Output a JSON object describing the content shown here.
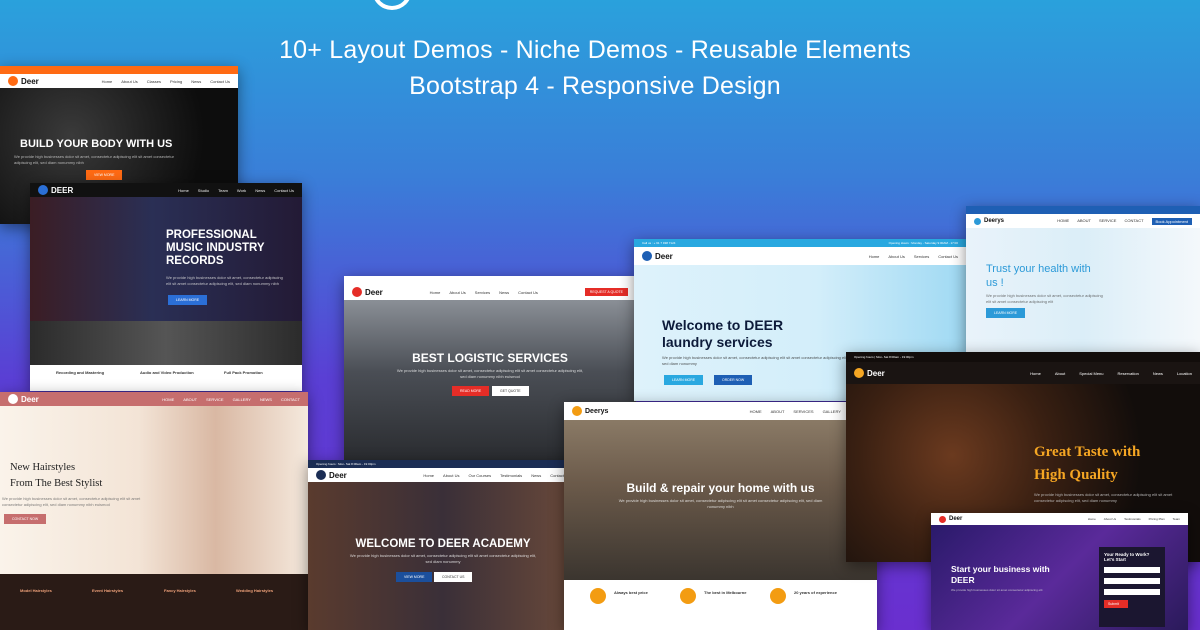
{
  "headline": {
    "line1": "10+ Layout Demos - Niche Demos - Reusable Elements",
    "line2": "Bootstrap 4 - Responsive Design"
  },
  "colors": {
    "fitness": "#ff6a13",
    "logistic": "#e52d27",
    "laundry": "#29a8e0",
    "coffee": "#f5a623",
    "construct": "#f39c12"
  },
  "demos": {
    "fitness": {
      "brand": "Deer",
      "menu": [
        "Home",
        "About Us",
        "Classes",
        "Pricing",
        "News",
        "Contact Us"
      ],
      "title": "BUILD YOUR BODY WITH US",
      "sub": "We provide high businesses dolor sit amet, consectetur adipiscing elit sit amet consectetur adipiscing elit, sed diam nonummy nibh",
      "btn": "VIEW MORE"
    },
    "music": {
      "brand": "DEER",
      "menu": [
        "Home",
        "Studio",
        "Team",
        "Work",
        "News",
        "Contact Us"
      ],
      "title": "PROFESSIONAL MUSIC INDUSTRY RECORDS",
      "sub": "We provide high businesses dolor sit amet, consectetur adipiscing elit sit amet consectetur adipiscing elit, sed diam nonummy nibh",
      "btn": "LEARN MORE",
      "features": [
        "Recording and Mastering",
        "Audio and Video Production",
        "Full Pack Promotion"
      ]
    },
    "salon": {
      "brand": "Deer",
      "menu": [
        "HOME",
        "ABOUT",
        "SERVICE",
        "GALLERY",
        "NEWS",
        "CONTACT"
      ],
      "title1": "New Hairstyles",
      "title2": "From The Best Stylist",
      "sub": "We provide high businesses dolor sit amet, consectetur adipiscing elit sit amet consectetur adipiscing elit, sed diam nonummy nibh euismod",
      "btn": "CONTACT NOW",
      "services": [
        "Model Hairstyles",
        "Event Hairstyles",
        "Fancy Hairstyles",
        "Wedding Hairstyles"
      ]
    },
    "logistic": {
      "brand": "Deer",
      "menu": [
        "Home",
        "About Us",
        "Services",
        "News",
        "Contact Us"
      ],
      "cta": "REQUEST A QUOTE",
      "title": "BEST LOGISTIC SERVICES",
      "sub": "We provide high businesses dolor sit amet, consectetur adipiscing elit sit amet consectetur adipiscing elit, sed diam nonummy nibh euismod",
      "btn1": "READ MORE",
      "btn2": "GET QUOTE"
    },
    "academy": {
      "topbar": "Opening hours : Mon- Sat 8:00am - 19:00pm",
      "brand": "Deer",
      "menu": [
        "Home",
        "About Us",
        "Our Courses",
        "Testimonials",
        "News",
        "Contact Us"
      ],
      "title": "WELCOME TO DEER ACADEMY",
      "sub": "We provide high businesses dolor sit amet, consectetur adipiscing elit sit amet consectetur adipiscing elit, sed diam nonummy",
      "btn1": "VIEW MORE",
      "btn2": "CONTACT US"
    },
    "laundry": {
      "topbar1": "Call us : + 61 7 938 7124",
      "topbar2": "Opening Hours : Monday - Saturday 9:00AM - 17:00",
      "brand": "Deer",
      "menu": [
        "Home",
        "About Us",
        "Services",
        "Contact Us"
      ],
      "title1": "Welcome to DEER",
      "title2": "laundry services",
      "sub": "We provide high businesses dolor sit amet, consectetur adipiscing elit sit amet consectetur adipiscing elit, sed diam nonummy",
      "btn1": "LEARN MORE",
      "btn2": "ORDER NOW"
    },
    "health": {
      "brand": "Deerys",
      "menu": [
        "HOME",
        "ABOUT",
        "SERVICE",
        "CONTACT"
      ],
      "cta": "Book Appointment",
      "title1": "Trust your health with",
      "title2": "us !",
      "sub": "We provide high businesses dolor sit amet, consectetur adipiscing elit sit amet consectetur adipiscing elit",
      "btn": "LEARN MORE"
    },
    "construct": {
      "brand": "Deerys",
      "menu": [
        "HOME",
        "ABOUT",
        "SERVICES",
        "GALLERY",
        "CONTACT"
      ],
      "title": "Build & repair your home with us",
      "sub": "We provide high businesses dolor sit amet, consectetur adipiscing elit sit amet consectetur adipiscing elit, sed diam nonummy nibh",
      "features": [
        "Always best price",
        "The best in Melbourne",
        "20 years of experience"
      ]
    },
    "coffee": {
      "topbar": "Opening hours | Mon- Sat 8:00am - 19:00pm",
      "brand": "Deer",
      "menu": [
        "Home",
        "About",
        "Special Menu",
        "Reservation",
        "News",
        "Location"
      ],
      "title1": "Great Taste with",
      "title2": "High Quality",
      "sub": "We provide high businesses dolor sit amet, consectetur adipiscing elit sit amet consectetur adipiscing elit, sed diam nonummy"
    },
    "business": {
      "brand": "Deer",
      "menu": [
        "Home",
        "About Us",
        "Testimonials",
        "Pricing Plan",
        "Team"
      ],
      "title1": "Start your business with",
      "title2": "DEER",
      "sub": "We provide high businesses dolor sit amet consectetur adipiscing elit",
      "form_title1": "Your Ready to Work?",
      "form_title2": "Let's Start",
      "btn": "Submit"
    }
  }
}
